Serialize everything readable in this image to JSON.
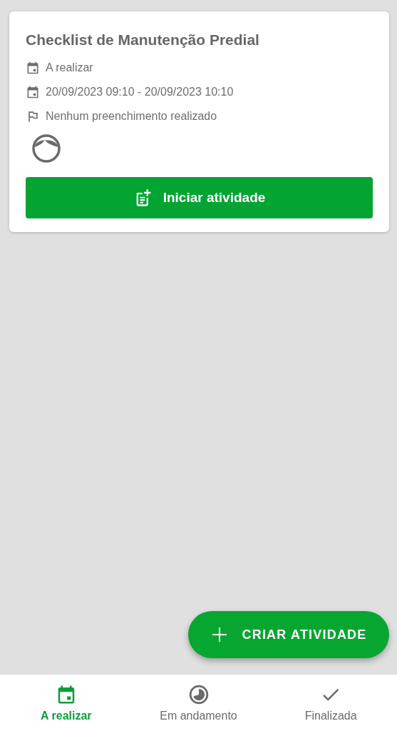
{
  "card": {
    "title": "Checklist de Manutenção Predial",
    "rows": [
      {
        "kind": "calendar",
        "text": "A realizar"
      },
      {
        "kind": "calendar",
        "text": "20/09/2023 09:10 - 20/09/2023 10:10"
      },
      {
        "kind": "flag",
        "text": "Nenhum preenchimento realizado"
      }
    ],
    "button": "Iniciar atividade"
  },
  "fab": {
    "label": "CRIAR ATIVIDADE"
  },
  "tabs": [
    {
      "kind": "calendar",
      "label": "A realizar",
      "selected": true
    },
    {
      "kind": "progress",
      "label": "Em andamento",
      "selected": false
    },
    {
      "kind": "check",
      "label": "Finalizada",
      "selected": false
    }
  ]
}
